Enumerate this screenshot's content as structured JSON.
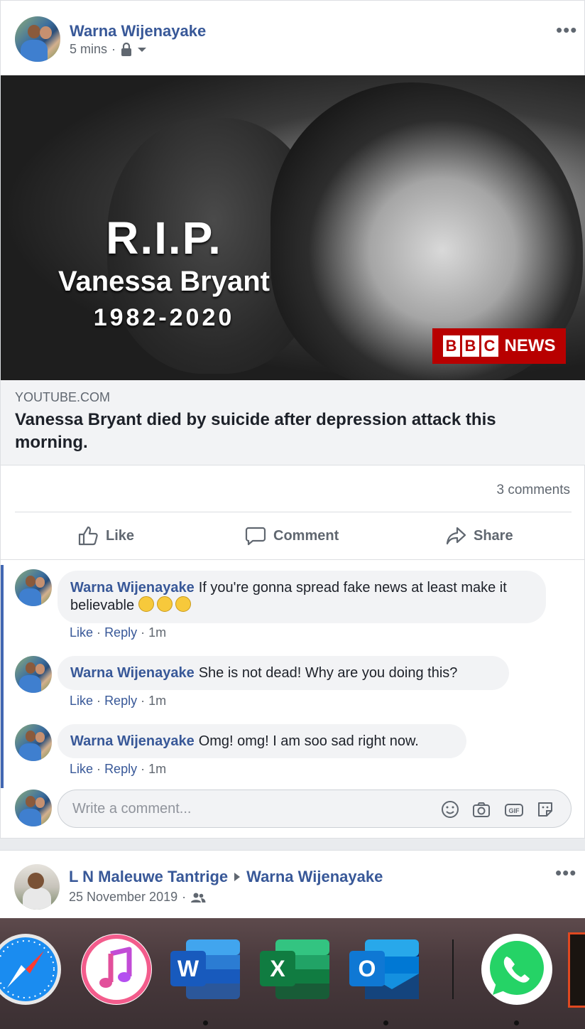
{
  "post": {
    "author": "Warna Wijenayake",
    "time": "5 mins",
    "meta_sep": "·",
    "more_label": "•••",
    "image": {
      "rip": "R.I.P.",
      "name": "Vanessa Bryant",
      "years": "1982-2020",
      "logo_letters": [
        "B",
        "B",
        "C"
      ],
      "logo_news": "NEWS"
    },
    "link": {
      "domain": "YOUTUBE.COM",
      "title": "Vanessa Bryant died by suicide after depression attack this morning."
    },
    "comment_count": "3 comments",
    "actions": {
      "like": "Like",
      "comment": "Comment",
      "share": "Share"
    }
  },
  "comments": [
    {
      "author": "Warna Wijenayake",
      "text": "If you're gonna spread fake news at least make it believable",
      "like": "Like",
      "sep": "·",
      "reply": "Reply",
      "time": "1m"
    },
    {
      "author": "Warna Wijenayake",
      "text": "She is not dead! Why are you doing this?",
      "like": "Like",
      "sep": "·",
      "reply": "Reply",
      "time": "1m"
    },
    {
      "author": "Warna Wijenayake",
      "text": "Omg! omg! I am soo sad right now.",
      "like": "Like",
      "sep": "·",
      "reply": "Reply",
      "time": "1m"
    }
  ],
  "write_comment": {
    "placeholder": "Write a comment..."
  },
  "post2": {
    "author": "L N Maleuwe Tantrige",
    "target": "Warna Wijenayake",
    "date": "25 November 2019",
    "meta_sep": "·",
    "more_label": "•••"
  },
  "dock": {
    "word_letter": "W",
    "excel_letter": "X",
    "outlook_letter": "O"
  },
  "colors": {
    "link_blue": "#385898",
    "accent_blue": "#4267b2",
    "bbc_red": "#b80000"
  }
}
